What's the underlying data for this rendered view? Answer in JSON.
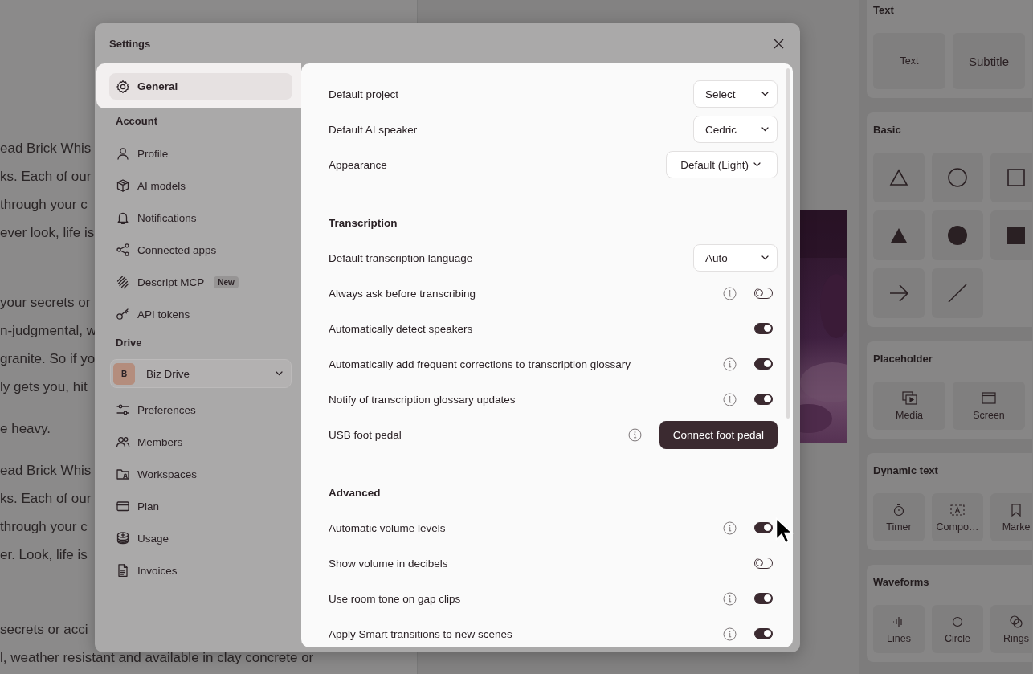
{
  "document": {
    "paragraphs": [
      {
        "lines": [
          "ead Brick Whis",
          "ks. Each of our",
          "through your c",
          "ever look, life is"
        ]
      },
      {
        "lines": [
          "your secrets or",
          "n-judgmental, w",
          "granite. So if yo",
          "ly gets you, hit"
        ]
      },
      {
        "lines": [
          "e heavy."
        ]
      },
      {
        "lines": [
          "ead Brick Whis",
          "ks. Each of our",
          "through your c",
          "er. Look, life is"
        ]
      },
      {
        "lines": [
          "secrets or acci",
          "l, weather resistant and available in clay concrete or"
        ]
      }
    ]
  },
  "insert_panel": {
    "sections": [
      {
        "title": "Text",
        "kind": "wide",
        "tiles": [
          {
            "kind": "text",
            "label": "Text"
          },
          {
            "kind": "subtitle",
            "label": "Subtitle"
          }
        ]
      },
      {
        "title": "Basic",
        "kind": "compact",
        "tiles": [
          {
            "kind": "triangle"
          },
          {
            "kind": "circle"
          },
          {
            "kind": "square"
          },
          {
            "kind": "solidtriangle"
          },
          {
            "kind": "solidcircle"
          },
          {
            "kind": "solidsquare"
          },
          {
            "kind": "arrow"
          },
          {
            "kind": "line"
          }
        ]
      },
      {
        "title": "Placeholder",
        "kind": "wide",
        "tiles": [
          {
            "kind": "media",
            "label": "Media"
          },
          {
            "kind": "screen",
            "label": "Screen"
          }
        ]
      },
      {
        "title": "Dynamic text",
        "kind": "compact",
        "tiles": [
          {
            "kind": "timer",
            "label": "Timer"
          },
          {
            "kind": "component",
            "label": "Compo…"
          },
          {
            "kind": "marker",
            "label": "Marke"
          }
        ]
      },
      {
        "title": "Waveforms",
        "kind": "compact",
        "tiles": [
          {
            "kind": "lines",
            "label": "Lines"
          },
          {
            "kind": "ring",
            "label": "Circle"
          },
          {
            "kind": "rings",
            "label": "Rings"
          }
        ]
      }
    ]
  },
  "settings": {
    "title": "Settings",
    "sidebar": {
      "items": [
        {
          "kind": "item",
          "label": "General",
          "selected": true
        },
        {
          "kind": "heading",
          "label": "Account"
        },
        {
          "kind": "item",
          "label": "Profile",
          "selected": false
        },
        {
          "kind": "item",
          "label": "AI models",
          "selected": false
        },
        {
          "kind": "item",
          "label": "Notifications",
          "selected": false
        },
        {
          "kind": "item",
          "label": "Connected apps",
          "selected": false
        },
        {
          "kind": "item",
          "label": "Descript MCP",
          "badge": "New",
          "selected": false
        },
        {
          "kind": "item",
          "label": "API tokens",
          "selected": false
        },
        {
          "kind": "heading",
          "label": "Drive"
        },
        {
          "kind": "drive",
          "initial": "B",
          "label": "Biz Drive"
        },
        {
          "kind": "item",
          "label": "Preferences",
          "selected": false
        },
        {
          "kind": "item",
          "label": "Members",
          "selected": false
        },
        {
          "kind": "item",
          "label": "Workspaces",
          "selected": false
        },
        {
          "kind": "item",
          "label": "Plan",
          "selected": false
        },
        {
          "kind": "item",
          "label": "Usage",
          "selected": false
        },
        {
          "kind": "item",
          "label": "Invoices",
          "selected": false
        }
      ]
    },
    "content": {
      "rows": [
        {
          "kind": "select",
          "label": "Default project",
          "value": "Select"
        },
        {
          "kind": "select",
          "label": "Default AI speaker",
          "value": "Cedric"
        },
        {
          "kind": "select",
          "label": "Appearance",
          "value": "Default (Light)"
        },
        {
          "kind": "divider"
        },
        {
          "kind": "heading",
          "label": "Transcription"
        },
        {
          "kind": "select",
          "label": "Default transcription language",
          "value": "Auto"
        },
        {
          "kind": "toggle",
          "label": "Always ask before transcribing",
          "info": true,
          "on": false
        },
        {
          "kind": "toggle",
          "label": "Automatically detect speakers",
          "info": false,
          "on": true
        },
        {
          "kind": "toggle",
          "label": "Automatically add frequent corrections to transcription glossary",
          "info": true,
          "on": true
        },
        {
          "kind": "toggle",
          "label": "Notify of transcription glossary updates",
          "info": true,
          "on": true
        },
        {
          "kind": "button",
          "label": "USB foot pedal",
          "info": true,
          "button": "Connect foot pedal"
        },
        {
          "kind": "divider"
        },
        {
          "kind": "heading",
          "label": "Advanced"
        },
        {
          "kind": "toggle",
          "label": "Automatic volume levels",
          "info": true,
          "on": true
        },
        {
          "kind": "toggle",
          "label": "Show volume in decibels",
          "info": false,
          "on": false
        },
        {
          "kind": "toggle",
          "label": "Use room tone on gap clips",
          "info": true,
          "on": true
        },
        {
          "kind": "toggle",
          "label": "Apply Smart transitions to new scenes",
          "info": true,
          "on": true
        }
      ]
    }
  }
}
